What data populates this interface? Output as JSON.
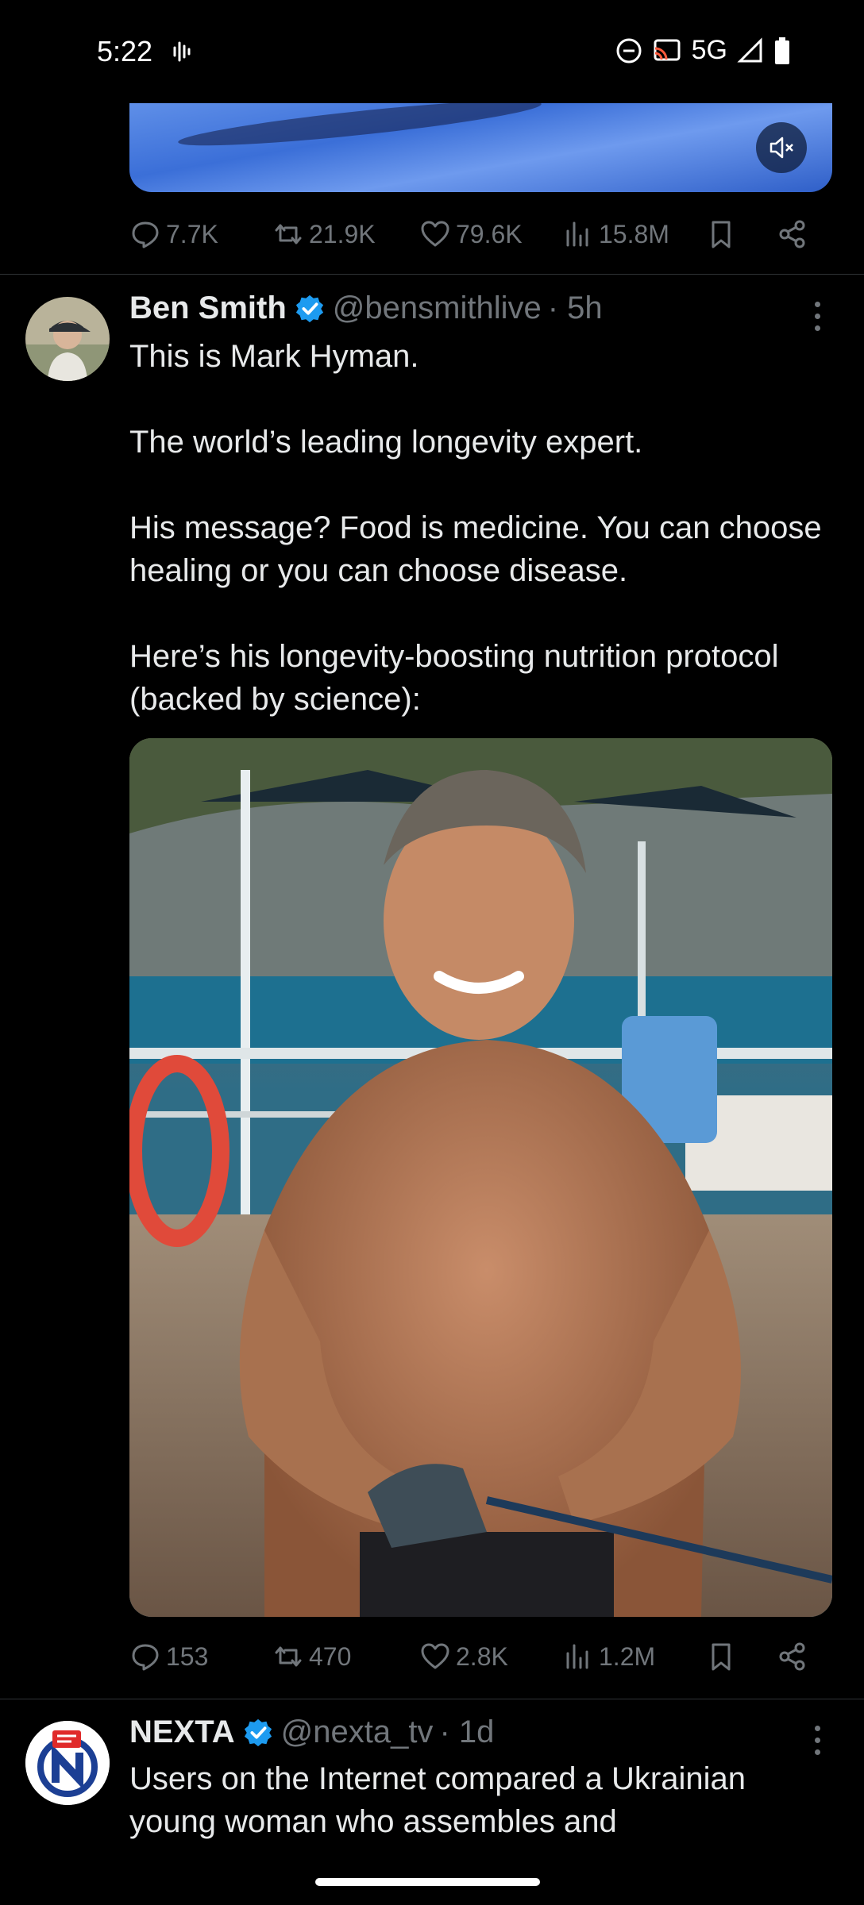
{
  "status_bar": {
    "time": "5:22",
    "network": "5G",
    "icons": [
      "sound-wave-icon",
      "do-not-disturb-icon",
      "cast-icon",
      "signal-icon",
      "battery-icon"
    ]
  },
  "tweet_prev": {
    "actions": {
      "replies": "7.7K",
      "reposts": "21.9K",
      "likes": "79.6K",
      "views": "15.8M"
    }
  },
  "tweet_main": {
    "author_name": "Ben Smith",
    "handle": "@bensmithlive",
    "time": "· 5h",
    "paragraphs": [
      "This is Mark Hyman.",
      "The world’s leading longevity expert.",
      "His message? Food is medicine. You can choose healing or you can choose disease.",
      "Here’s his longevity-boosting nutrition protocol (backed by science):"
    ],
    "actions": {
      "replies": "153",
      "reposts": "470",
      "likes": "2.8K",
      "views": "1.2M"
    }
  },
  "tweet_next": {
    "author_name": "NEXTA",
    "handle": "@nexta_tv",
    "time": "· 1d",
    "text": "Users on the Internet compared a Ukrainian young woman who assembles and"
  },
  "colors": {
    "background": "#000000",
    "text_primary": "#e7e9ea",
    "text_secondary": "#71767b",
    "verified_blue": "#1d9bf0",
    "divider": "#2f3336"
  }
}
